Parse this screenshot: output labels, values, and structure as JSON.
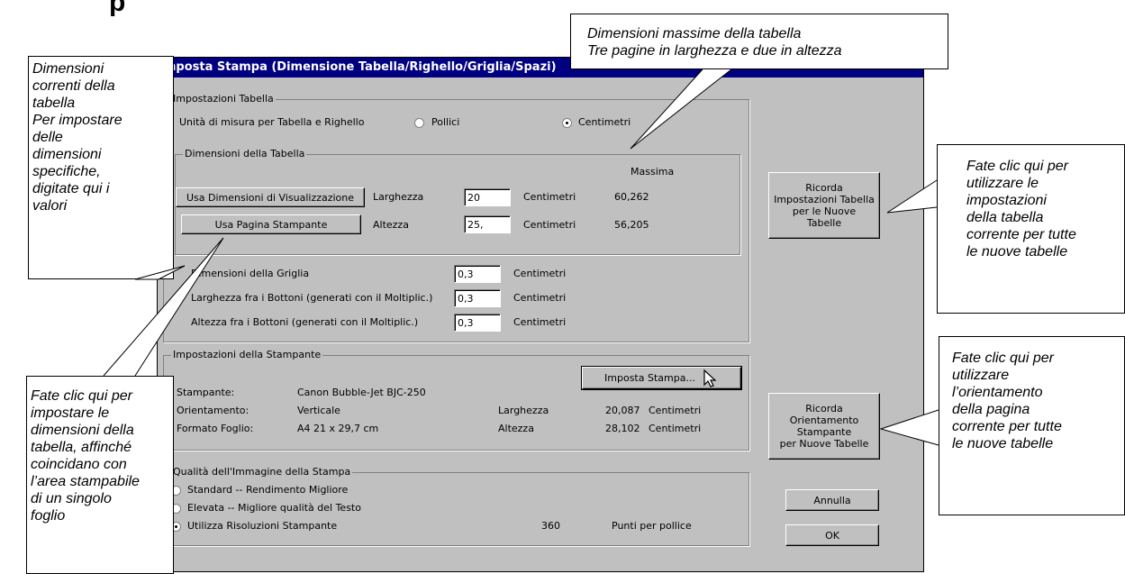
{
  "dialog": {
    "title": "Imposta Stampa (Dimensione Tabella/Righello/Griglia/Spazi)",
    "table_settings": {
      "group_label": "Impostazioni Tabella",
      "units_label": "Unità di misura per Tabella e Righello",
      "unit_options": [
        "Pollici",
        "Centimetri"
      ],
      "selected_unit": "Centimetri"
    },
    "dimensions": {
      "group_label": "Dimensioni della Tabella",
      "max_header": "Massima",
      "use_display_button": "Usa Dimensioni di Visualizzazione",
      "use_page_button": "Usa Pagina Stampante",
      "width_label": "Larghezza",
      "width_value": "20",
      "height_label": "Altezza",
      "height_value": "25,",
      "unit": "Centimetri",
      "max_width": "60,262",
      "max_height": "56,205"
    },
    "grid": {
      "grid_label": "Dimensioni della Griglia",
      "grid_value": "0,3",
      "btn_width_label": "Larghezza fra i Bottoni (generati con il Moltiplic.)",
      "btn_width_value": "0,3",
      "btn_height_label": "Altezza fra i Bottoni (generati con il Moltiplic.)",
      "btn_height_value": "0,3",
      "unit": "Centimetri"
    },
    "printer": {
      "group_label": "Impostazioni della Stampante",
      "setup_button": "Imposta Stampa...",
      "printer_label": "Stampante:",
      "printer_value": "Canon Bubble-Jet BJC-250",
      "orientation_label": "Orientamento:",
      "orientation_value": "Verticale",
      "paper_label": "Formato Foglio:",
      "paper_value": "A4 21 x 29,7 cm",
      "width_label": "Larghezza",
      "width_value": "20,087",
      "height_label": "Altezza",
      "height_value": "28,102",
      "unit": "Centimetri"
    },
    "quality": {
      "group_label": "Qualità dell'Immagine della Stampa",
      "options": [
        "Standard  -- Rendimento Migliore",
        "Elevata  --  Migliore qualità del Testo",
        "Utilizza Risoluzioni Stampante"
      ],
      "dpi_value": "360",
      "dpi_label": "Punti per pollice"
    },
    "buttons": {
      "remember_table": "Ricorda\nImpostazioni Tabella\nper le Nuove\nTabelle",
      "remember_orientation": "Ricorda\nOrientamento\nStampante\nper Nuove Tabelle",
      "cancel": "Annulla",
      "ok": "OK"
    }
  },
  "callouts": {
    "current_dims": "Dimensioni\ncorrenti della\ntabella\nPer impostare\ndelle\ndimensioni\nspecifiche,\ndigitate qui i\nvalori",
    "max_dims": "Dimensioni massime della tabella\nTre pagine in larghezza e due in altezza",
    "remember_table": "Fate clic qui per\nutilizzare le\nimpostazioni\ndella tabella\ncorrente per tutte\nle nuove tabelle",
    "remember_orientation": "Fate clic qui per\nutilizzare\nl’orientamento\ndella pagina\ncorrente per tutte\nle nuove tabelle",
    "use_page": "Fate clic qui per\nimpostare le\ndimensioni della\ntabella, affinché\ncoincidano con\nl’area stampabile\ndi un singolo\nfoglio"
  },
  "heading_fragment": "p"
}
